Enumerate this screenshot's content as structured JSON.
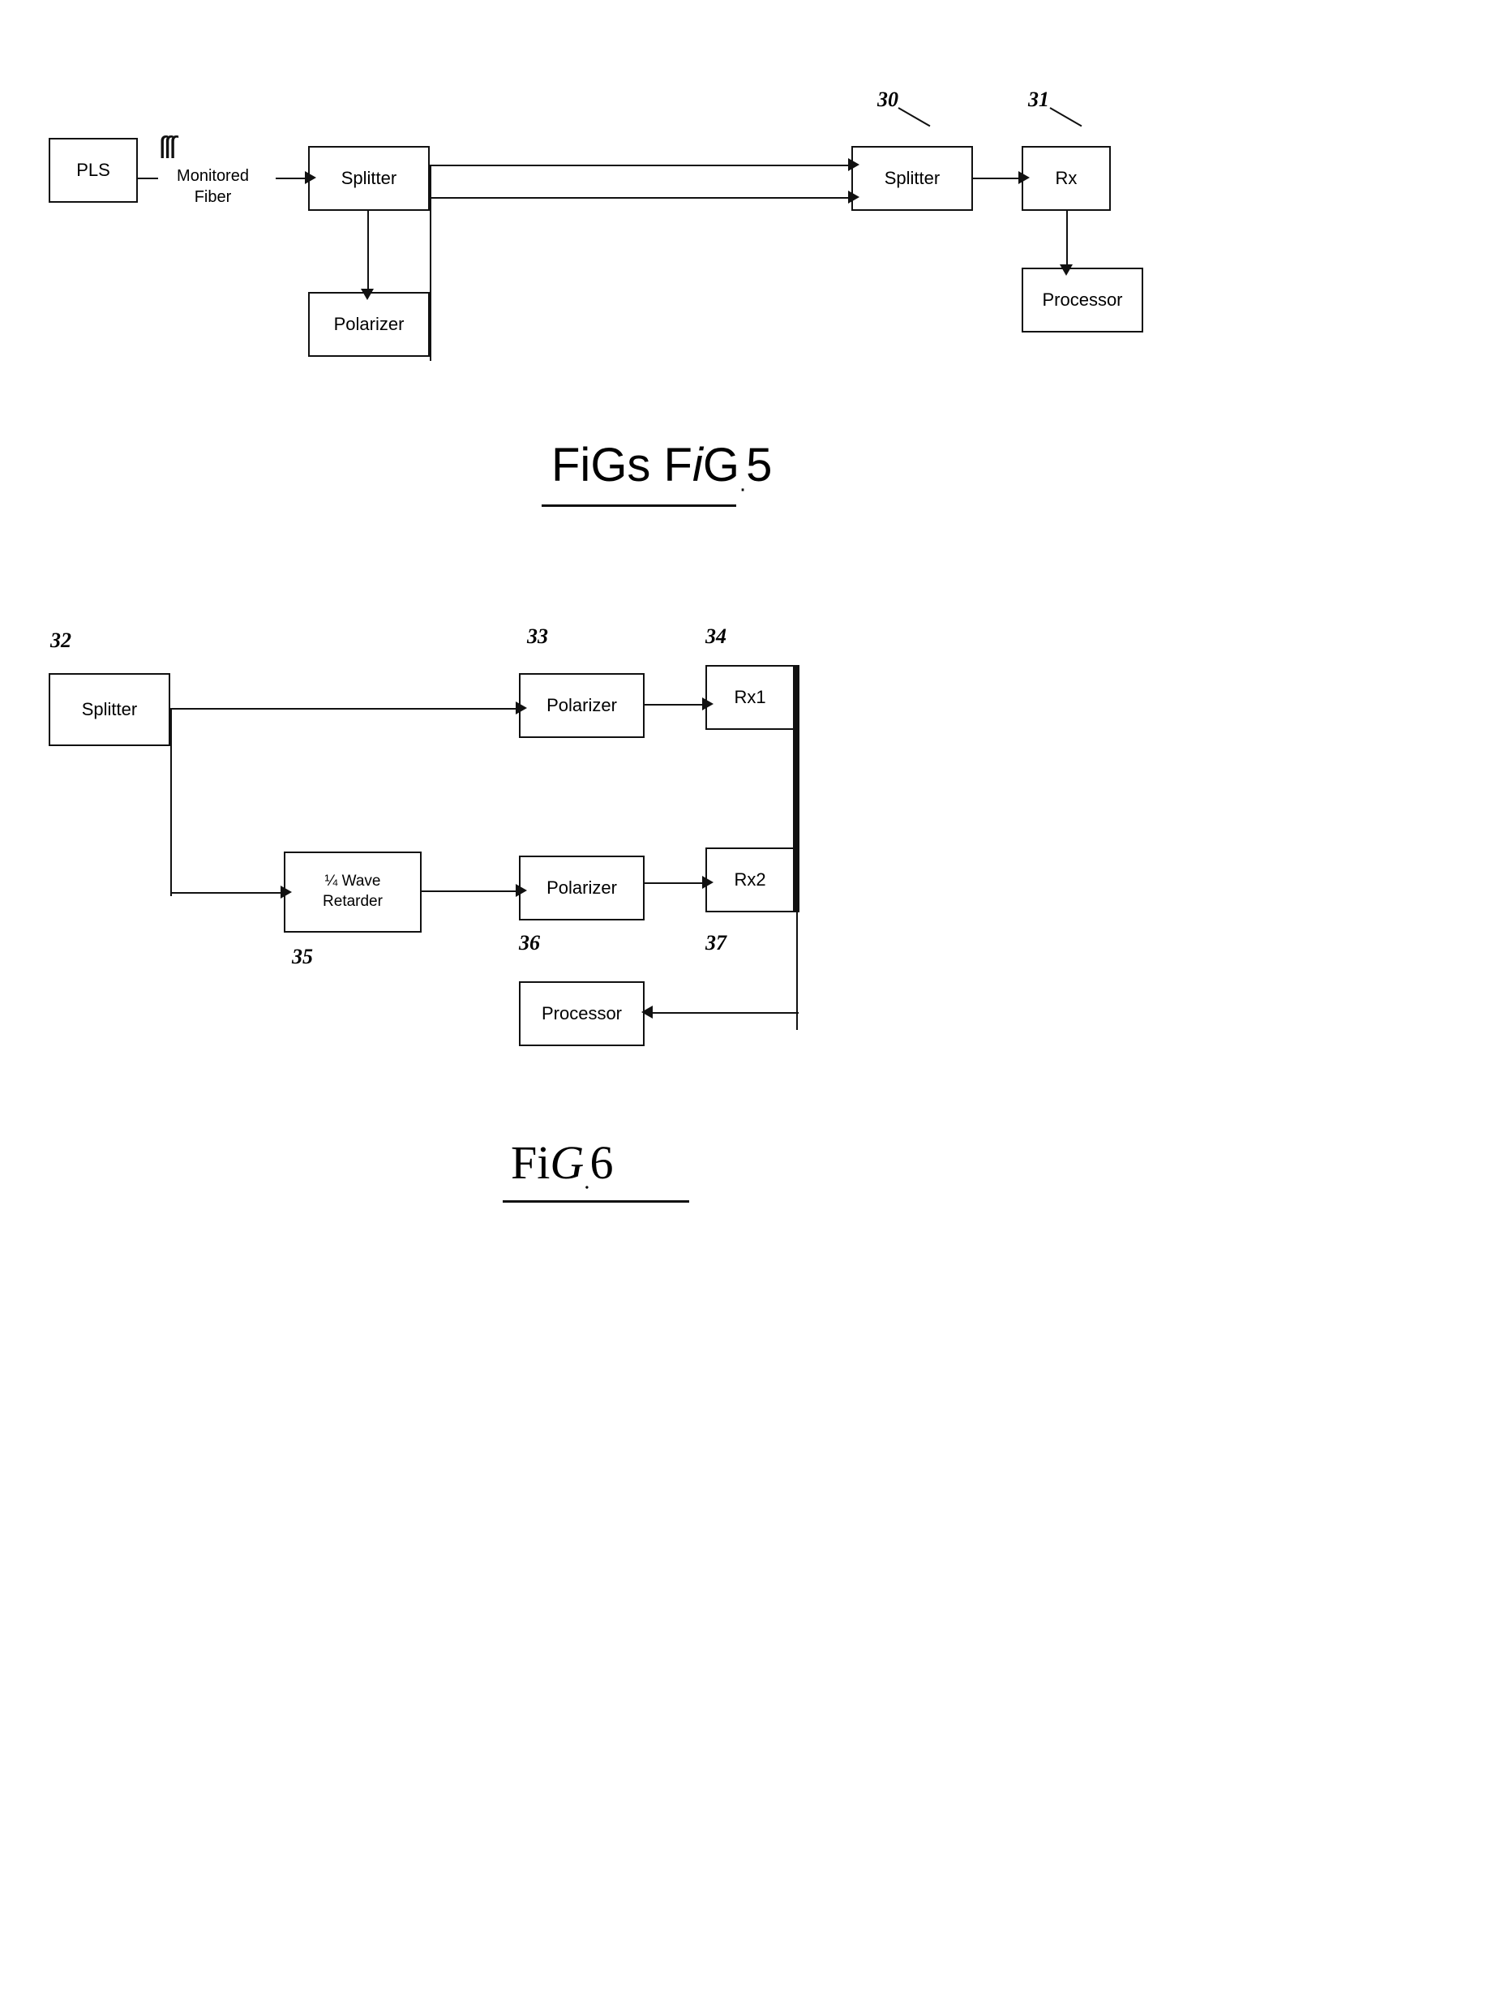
{
  "fig5": {
    "title": "FiGs",
    "title_label": "FIG. 5",
    "boxes": {
      "pls": {
        "label": "PLS"
      },
      "monitored_fiber": {
        "label": "Monitored\nFiber"
      },
      "splitter1": {
        "label": "Splitter"
      },
      "polarizer1": {
        "label": "Polarizer"
      },
      "splitter2": {
        "label": "Splitter"
      },
      "rx": {
        "label": "Rx"
      },
      "processor1": {
        "label": "Processor"
      }
    },
    "ref_numbers": {
      "r30": "30",
      "r31": "31"
    }
  },
  "fig6": {
    "title": "FiGs 6",
    "title_label": "FIG. 6",
    "boxes": {
      "splitter": {
        "label": "Splitter"
      },
      "polarizer_top": {
        "label": "Polarizer"
      },
      "rx1": {
        "label": "Rx1"
      },
      "wave_retarder": {
        "label": "¼ Wave\nRetarder"
      },
      "polarizer_bot": {
        "label": "Polarizer"
      },
      "rx2": {
        "label": "Rx2"
      },
      "processor": {
        "label": "Processor"
      }
    },
    "ref_numbers": {
      "r32": "32",
      "r33": "33",
      "r34": "34",
      "r35": "35",
      "r36": "36",
      "r37": "37"
    }
  }
}
